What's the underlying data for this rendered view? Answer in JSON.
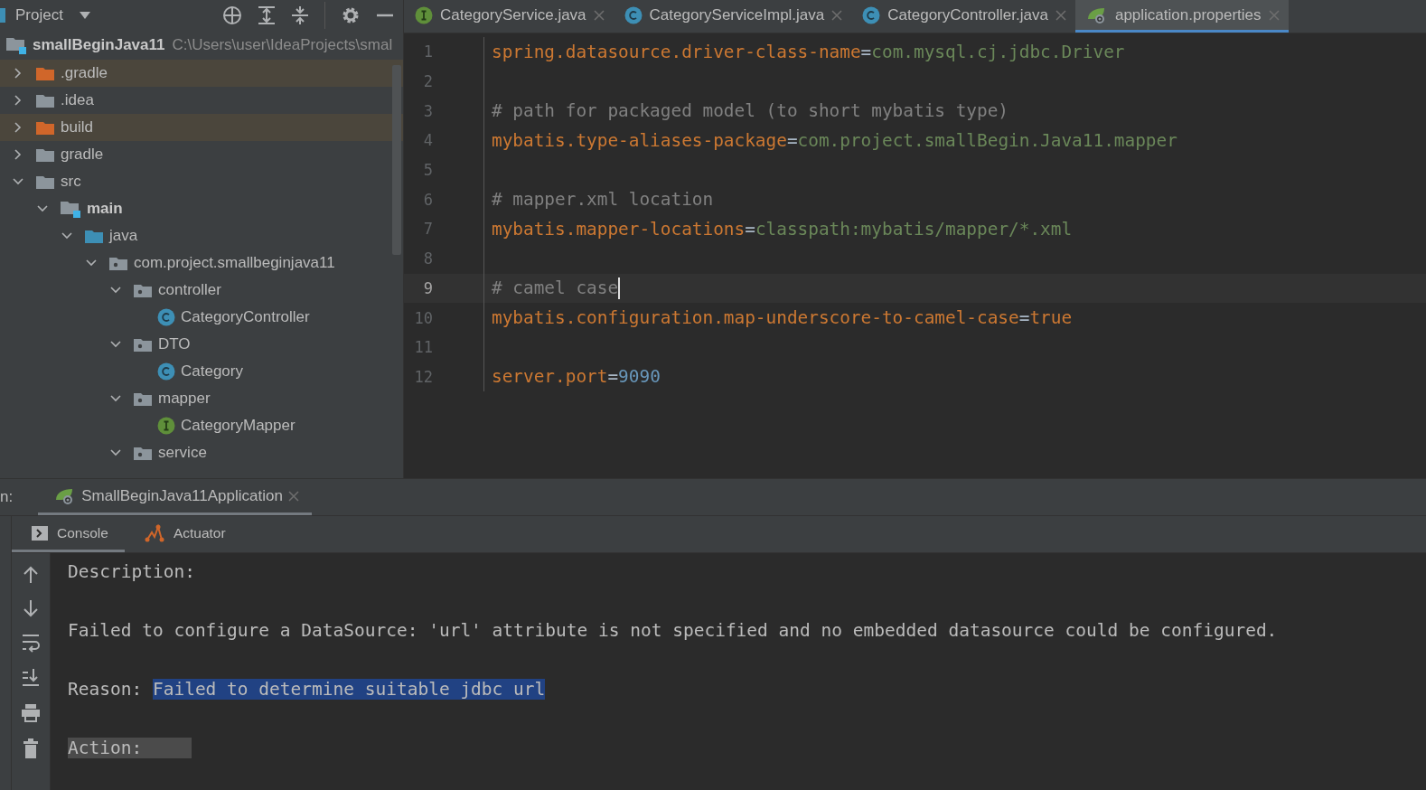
{
  "project_panel": {
    "title": "Project",
    "root": {
      "label": "smallBeginJava11",
      "path": "C:\\Users\\user\\IdeaProjects\\smal",
      "kind": "module"
    },
    "tree": [
      {
        "label": ".gradle",
        "kind": "folder",
        "excluded": true,
        "expanded": false
      },
      {
        "label": ".idea",
        "kind": "folder",
        "excluded": false,
        "expanded": false
      },
      {
        "label": "build",
        "kind": "folder",
        "excluded": true,
        "expanded": false
      },
      {
        "label": "gradle",
        "kind": "folder",
        "excluded": false,
        "expanded": false
      },
      {
        "label": "src",
        "kind": "folder",
        "excluded": false,
        "expanded": true,
        "children": [
          {
            "label": "main",
            "kind": "module",
            "excluded": false,
            "expanded": true,
            "children": [
              {
                "label": "java",
                "kind": "source",
                "excluded": false,
                "expanded": true,
                "children": [
                  {
                    "label": "com.project.smallbeginjava11",
                    "kind": "package",
                    "excluded": false,
                    "expanded": true,
                    "children": [
                      {
                        "label": "controller",
                        "kind": "package",
                        "excluded": false,
                        "expanded": true,
                        "children": [
                          {
                            "label": "CategoryController",
                            "kind": "class",
                            "excluded": false
                          }
                        ]
                      },
                      {
                        "label": "DTO",
                        "kind": "package",
                        "excluded": false,
                        "expanded": true,
                        "children": [
                          {
                            "label": "Category",
                            "kind": "class",
                            "excluded": false
                          }
                        ]
                      },
                      {
                        "label": "mapper",
                        "kind": "package",
                        "excluded": false,
                        "expanded": true,
                        "children": [
                          {
                            "label": "CategoryMapper",
                            "kind": "interface",
                            "excluded": false
                          }
                        ]
                      },
                      {
                        "label": "service",
                        "kind": "package",
                        "excluded": false,
                        "expanded": true
                      }
                    ]
                  }
                ]
              }
            ]
          }
        ]
      }
    ]
  },
  "editor_tabs": [
    {
      "label": "CategoryService.java",
      "kind": "interface",
      "selected": false
    },
    {
      "label": "CategoryServiceImpl.java",
      "kind": "class",
      "selected": false
    },
    {
      "label": "CategoryController.java",
      "kind": "class",
      "selected": false
    },
    {
      "label": "application.properties",
      "kind": "spring",
      "selected": true
    }
  ],
  "code_lines": [
    {
      "number": "1",
      "current": false,
      "tokens": [
        {
          "kind": "key",
          "text": "spring.datasource.driver-class-name"
        },
        {
          "kind": "sep",
          "text": "="
        },
        {
          "kind": "value",
          "text": "com.mysql.cj.jdbc.Driver"
        }
      ]
    },
    {
      "number": "2",
      "current": false
    },
    {
      "number": "3",
      "current": false,
      "tokens": [
        {
          "kind": "comment",
          "text": "# path for packaged model (to short mybatis type)"
        }
      ]
    },
    {
      "number": "4",
      "current": false,
      "tokens": [
        {
          "kind": "key",
          "text": "mybatis.type-aliases-package"
        },
        {
          "kind": "sep",
          "text": "="
        },
        {
          "kind": "value",
          "text": "com.project.smallBegin.Java11.mapper"
        }
      ]
    },
    {
      "number": "5",
      "current": false
    },
    {
      "number": "6",
      "current": false,
      "tokens": [
        {
          "kind": "comment",
          "text": "# mapper.xml location"
        }
      ]
    },
    {
      "number": "7",
      "current": false,
      "tokens": [
        {
          "kind": "key",
          "text": "mybatis.mapper-locations"
        },
        {
          "kind": "sep",
          "text": "="
        },
        {
          "kind": "value",
          "text": "classpath:mybatis/mapper/*.xml"
        }
      ]
    },
    {
      "number": "8",
      "current": false
    },
    {
      "number": "9",
      "current": true,
      "tokens": [
        {
          "kind": "comment",
          "text": "# camel case"
        }
      ]
    },
    {
      "number": "10",
      "current": false,
      "tokens": [
        {
          "kind": "key",
          "text": "mybatis.configuration.map-underscore-to-camel-case"
        },
        {
          "kind": "sep",
          "text": "="
        },
        {
          "kind": "keyword",
          "text": "true"
        }
      ]
    },
    {
      "number": "11",
      "current": false
    },
    {
      "number": "12",
      "current": false,
      "tokens": [
        {
          "kind": "key",
          "text": "server.port"
        },
        {
          "kind": "sep",
          "text": "="
        },
        {
          "kind": "number",
          "text": "9090"
        }
      ]
    }
  ],
  "run_panel": {
    "label": "n:",
    "tabs": [
      {
        "label": "SmallBeginJava11Application",
        "selected": true
      }
    ],
    "console_tabs": [
      {
        "label": "Console",
        "kind": "console",
        "selected": true
      },
      {
        "label": "Actuator",
        "kind": "actuator",
        "selected": false
      }
    ],
    "console_lines": [
      {
        "segments": [
          {
            "text": "Description:",
            "selected": false,
            "highlighted": false
          }
        ]
      },
      {
        "segments": [
          {
            "text": "Failed to configure a DataSource: 'url' attribute is not specified and no embedded datasource could be configured.",
            "selected": false,
            "highlighted": false
          }
        ]
      },
      {
        "segments": [
          {
            "text": "Reason: ",
            "selected": false,
            "highlighted": false
          },
          {
            "text": "Failed to determine suitable jdbc url",
            "selected": true,
            "highlighted": false
          }
        ]
      },
      {
        "segments": [
          {
            "text": "Action:",
            "selected": false,
            "highlighted": true
          }
        ]
      }
    ]
  }
}
